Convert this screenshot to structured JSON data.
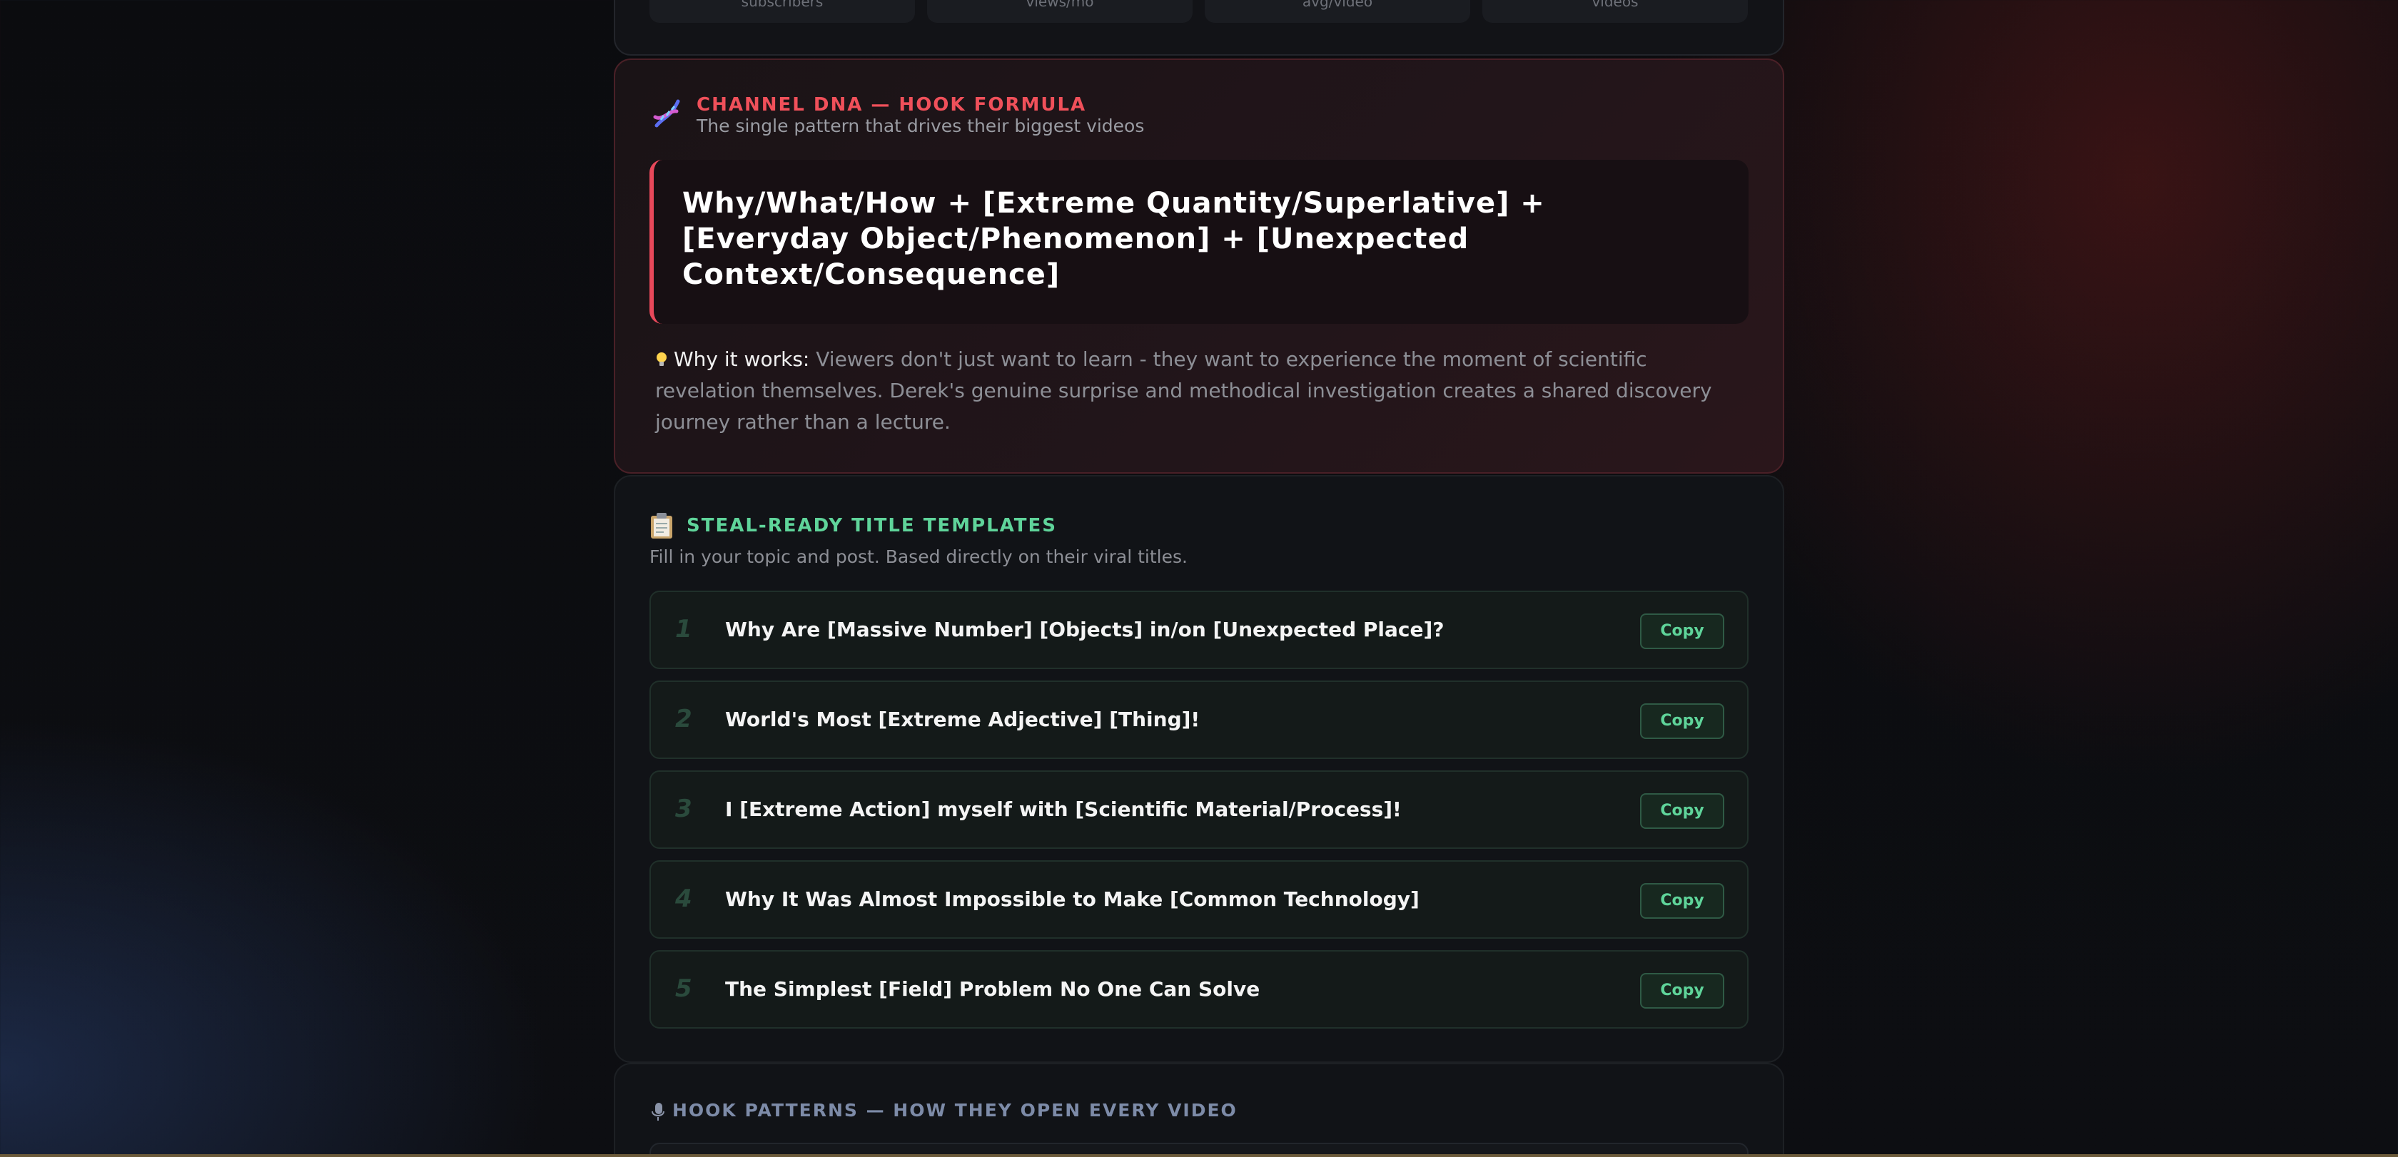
{
  "stats": {
    "tiles": [
      "subscribers",
      "views/mo",
      "avg/video",
      "videos"
    ]
  },
  "dna": {
    "title": "CHANNEL DNA — HOOK FORMULA",
    "subtitle": "The single pattern that drives their biggest videos",
    "formula": "Why/What/How + [Extreme Quantity/Superlative] + [Everyday Object/Phenomenon] + [Unexpected Context/Consequence]",
    "why_label": "Why it works:",
    "why_text": "Viewers don't just want to learn - they want to experience the moment of scientific revelation themselves. Derek's genuine surprise and methodical investigation creates a shared discovery journey rather than a lecture.",
    "icon": "dna-icon",
    "accent": "#f0505a"
  },
  "templates": {
    "title": "STEAL-READY TITLE TEMPLATES",
    "subtitle": "Fill in your topic and post. Based directly on their viral titles.",
    "icon": "clipboard-icon",
    "accent": "#5fd49a",
    "copy_label": "Copy",
    "items": [
      {
        "num": "1",
        "text": "Why Are [Massive Number] [Objects] in/on [Unexpected Place]?"
      },
      {
        "num": "2",
        "text": "World's Most [Extreme Adjective] [Thing]!"
      },
      {
        "num": "3",
        "text": "I [Extreme Action] myself with [Scientific Material/Process]!"
      },
      {
        "num": "4",
        "text": "Why It Was Almost Impossible to Make [Common Technology]"
      },
      {
        "num": "5",
        "text": "The Simplest [Field] Problem No One Can Solve"
      }
    ]
  },
  "hooks": {
    "title": "HOOK PATTERNS — HOW THEY OPEN EVERY VIDEO",
    "icon": "microphone-icon"
  }
}
